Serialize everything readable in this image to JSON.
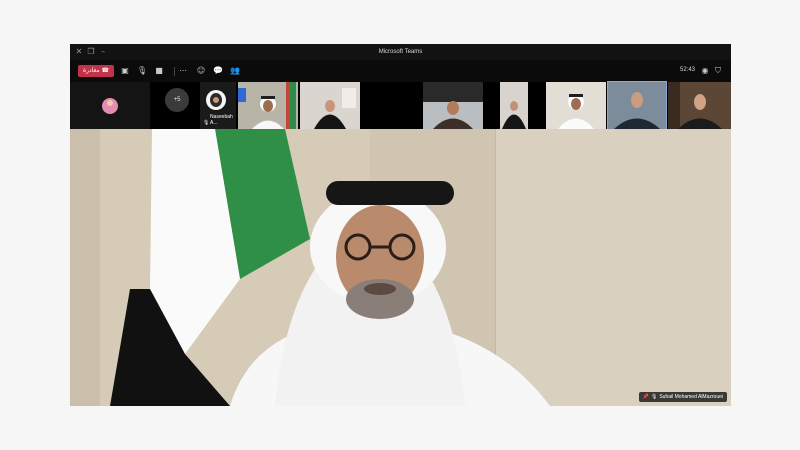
{
  "window": {
    "title": "Microsoft Teams"
  },
  "toolbar": {
    "leave_label": "مغادرة",
    "timer": "52:43"
  },
  "participants_strip": {
    "overflow_count": "+5",
    "tiles": [
      {
        "label": "Naseebah A..."
      }
    ]
  },
  "main_video": {
    "speaker_name": "Suhail Mohamed AlMazrouei"
  },
  "colors": {
    "leave_button": "#c4314b",
    "window_bg": "#0b0b0b"
  }
}
